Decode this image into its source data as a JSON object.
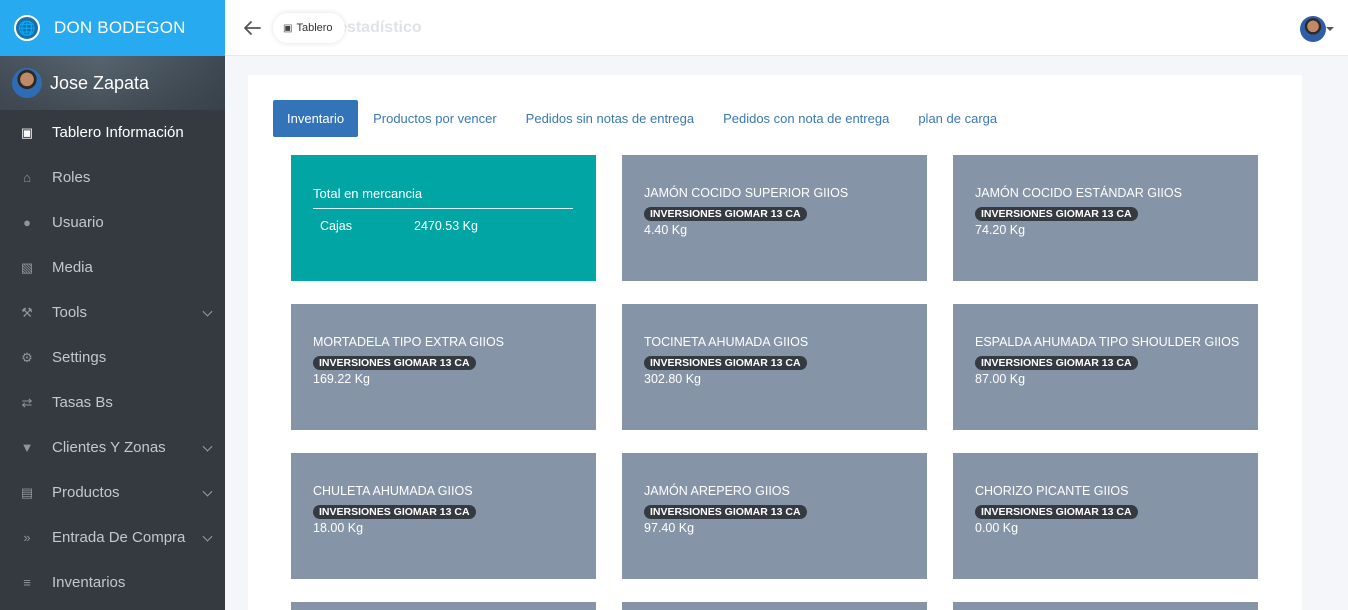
{
  "brand": {
    "name": "DON BODEGON",
    "logo_icon": "globe-icon"
  },
  "user": {
    "name": "Jose Zapata"
  },
  "sidebar": {
    "items": [
      {
        "label": "Tablero Información",
        "icon": "dashboard-icon",
        "active": true,
        "has_children": false
      },
      {
        "label": "Roles",
        "icon": "lock-icon",
        "active": false,
        "has_children": false
      },
      {
        "label": "Usuario",
        "icon": "user-icon",
        "active": false,
        "has_children": false
      },
      {
        "label": "Media",
        "icon": "image-icon",
        "active": false,
        "has_children": false
      },
      {
        "label": "Tools",
        "icon": "tools-icon",
        "active": false,
        "has_children": true
      },
      {
        "label": "Settings",
        "icon": "gear-icon",
        "active": false,
        "has_children": false
      },
      {
        "label": "Tasas Bs",
        "icon": "exchange-icon",
        "active": false,
        "has_children": false
      },
      {
        "label": "Clientes Y Zonas",
        "icon": "map-pin-icon",
        "active": false,
        "has_children": true
      },
      {
        "label": "Productos",
        "icon": "cart-icon",
        "active": false,
        "has_children": true
      },
      {
        "label": "Entrada De Compra",
        "icon": "double-chevron-icon",
        "active": false,
        "has_children": true
      },
      {
        "label": "Inventarios",
        "icon": "database-icon",
        "active": false,
        "has_children": false
      }
    ]
  },
  "header": {
    "title": "Tablero estadístico",
    "chip": "Tablero"
  },
  "tabs": [
    {
      "label": "Inventario",
      "active": true
    },
    {
      "label": "Productos por vencer",
      "active": false
    },
    {
      "label": "Pedidos sin notas de entrega",
      "active": false
    },
    {
      "label": "Pedidos con nota de entrega",
      "active": false
    },
    {
      "label": "plan de carga",
      "active": false
    }
  ],
  "total_card": {
    "title": "Total en mercancia",
    "label": "Cajas",
    "value": "2470.53 Kg"
  },
  "products": [
    {
      "name": "JAMÓN COCIDO SUPERIOR GIIOS",
      "company": "INVERSIONES GIOMAR 13 CA",
      "qty": "4.40 Kg"
    },
    {
      "name": "JAMÓN COCIDO ESTÁNDAR GIIOS",
      "company": "INVERSIONES GIOMAR 13 CA",
      "qty": "74.20 Kg"
    },
    {
      "name": "MORTADELA TIPO EXTRA GIIOS",
      "company": "INVERSIONES GIOMAR 13 CA",
      "qty": "169.22 Kg"
    },
    {
      "name": "TOCINETA AHUMADA GIIOS",
      "company": "INVERSIONES GIOMAR 13 CA",
      "qty": "302.80 Kg"
    },
    {
      "name": "ESPALDA AHUMADA TIPO SHOULDER GIIOS",
      "company": "INVERSIONES GIOMAR 13 CA",
      "qty": "87.00 Kg"
    },
    {
      "name": "CHULETA AHUMADA GIIOS",
      "company": "INVERSIONES GIOMAR 13 CA",
      "qty": "18.00 Kg"
    },
    {
      "name": "JAMÓN AREPERO GIIOS",
      "company": "INVERSIONES GIOMAR 13 CA",
      "qty": "97.40 Kg"
    },
    {
      "name": "CHORIZO PICANTE GIIOS",
      "company": "INVERSIONES GIOMAR 13 CA",
      "qty": "0.00 Kg"
    }
  ],
  "colors": {
    "brand": "#27aaf0",
    "sidebar": "#343a40",
    "tab_active": "#3374b8",
    "teal_card": "#00a5a4",
    "product_card": "#8694a7"
  }
}
